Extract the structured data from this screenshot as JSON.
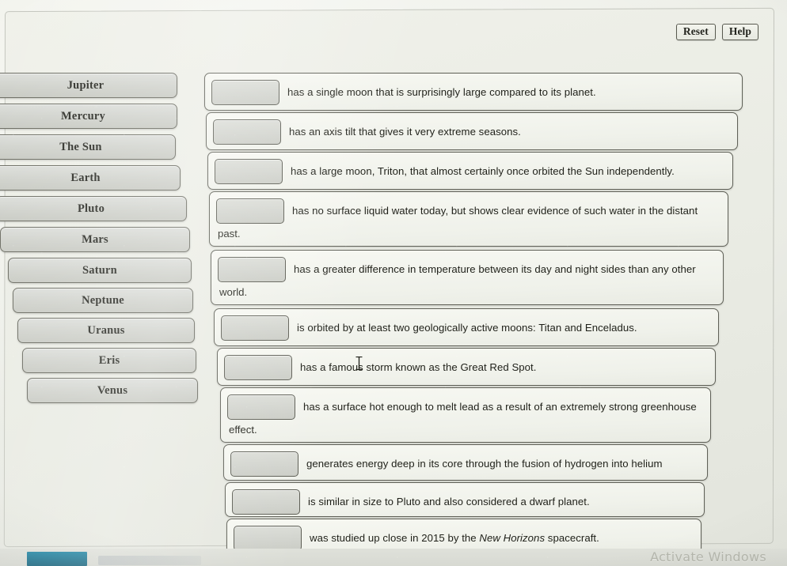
{
  "activity": {
    "type": "drag-and-drop-matching",
    "toolbar": {
      "reset_label": "Reset",
      "help_label": "Help"
    },
    "drag_items": [
      {
        "label": "Jupiter"
      },
      {
        "label": "Mercury"
      },
      {
        "label": "The Sun"
      },
      {
        "label": "Earth"
      },
      {
        "label": "Pluto"
      },
      {
        "label": "Mars"
      },
      {
        "label": "Saturn"
      },
      {
        "label": "Neptune"
      },
      {
        "label": "Uranus"
      },
      {
        "label": "Eris"
      },
      {
        "label": "Venus"
      }
    ],
    "statements": [
      {
        "text": "has a single moon that is surprisingly large compared to its planet.",
        "drop_value": "",
        "wrapped": false,
        "wrap_tail": ""
      },
      {
        "text": "has an axis tilt that gives it very extreme seasons.",
        "drop_value": "",
        "wrapped": false,
        "wrap_tail": ""
      },
      {
        "text": "has a large moon, Triton, that almost certainly once orbited the Sun independently.",
        "drop_value": "",
        "wrapped": false,
        "wrap_tail": ""
      },
      {
        "text": "has no surface liquid water today, but shows clear evidence of such water in the distant",
        "drop_value": "",
        "wrapped": true,
        "wrap_tail": "past."
      },
      {
        "text": "has a greater difference in temperature between its day and night sides than any other",
        "drop_value": "",
        "wrapped": true,
        "wrap_tail": "world."
      },
      {
        "text": "is orbited by at least two geologically active moons: Titan and Enceladus.",
        "drop_value": "",
        "wrapped": false,
        "wrap_tail": ""
      },
      {
        "text": "has a famous storm known as the Great Red Spot.",
        "drop_value": "",
        "wrapped": false,
        "wrap_tail": ""
      },
      {
        "text": "has a surface hot enough to melt lead as a result of an extremely strong greenhouse",
        "drop_value": "",
        "wrapped": true,
        "wrap_tail": "effect."
      },
      {
        "text": "generates energy deep in its core through the fusion of hydrogen into helium",
        "drop_value": "",
        "wrapped": false,
        "wrap_tail": ""
      },
      {
        "text": "is similar in size to Pluto and also considered a dwarf planet.",
        "drop_value": "",
        "wrapped": false,
        "wrap_tail": ""
      },
      {
        "text_before_italic": "was studied up close in 2015 by the ",
        "italic_text": "New Horizons",
        "text_after_italic": " spacecraft.",
        "text": "was studied up close in 2015 by the New Horizons spacecraft.",
        "drop_value": "",
        "wrapped": false,
        "wrap_tail": ""
      }
    ]
  },
  "os_overlay": {
    "watermark": "Activate Windows"
  },
  "colors": {
    "page_background": "#e9ebe4",
    "chip_fill": "#d0d2cc",
    "chip_border": "#6b6c62",
    "statement_fill": "#eff1ea",
    "statement_border": "#5f6057",
    "drop_slot_fill": "#d1d3cd",
    "text": "#1f2019",
    "watermark_text": "#b4b6ac",
    "taskbar_accent": "#12607a"
  }
}
